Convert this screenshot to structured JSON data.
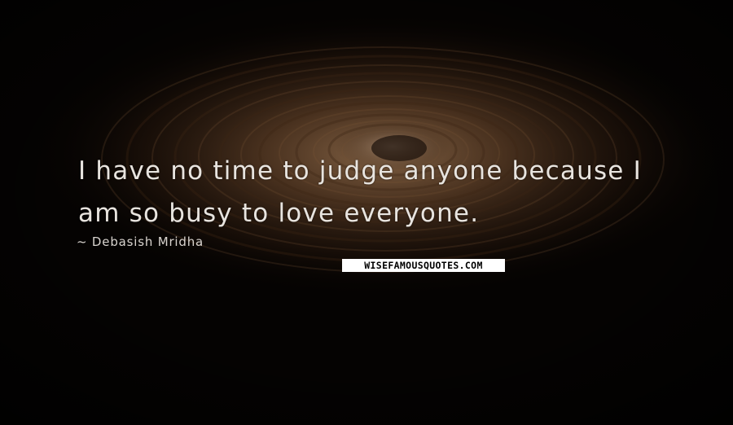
{
  "quote": {
    "line_1": "I have no time to judge anyone because I",
    "line_2": "am so busy to love everyone."
  },
  "author": {
    "text": "~ Debasish Mridha"
  },
  "watermark": {
    "text": "WISEFAMOUSQUOTES.COM"
  },
  "colors": {
    "background": "#050302",
    "glow": "#6b4a2e",
    "text": "#e8e4df"
  }
}
